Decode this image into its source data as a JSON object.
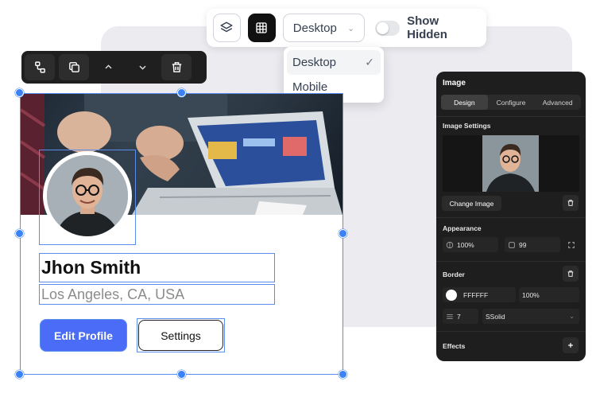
{
  "toolbar": {
    "device_selected": "Desktop",
    "show_hidden_label": "Show Hidden"
  },
  "device_dropdown": {
    "options": [
      {
        "label": "Desktop",
        "selected": true
      },
      {
        "label": "Mobile",
        "selected": false
      }
    ]
  },
  "element_toolbar": {
    "icons": [
      "hierarchy-icon",
      "duplicate-icon",
      "move-up-icon",
      "move-down-icon",
      "delete-icon"
    ]
  },
  "card": {
    "name": "Jhon Smith",
    "location": "Los Angeles, CA, USA",
    "edit_button": "Edit Profile",
    "settings_button": "Settings",
    "accent_color": "#4a6cf7",
    "selection_color": "#3b82f6"
  },
  "panel": {
    "title": "Image",
    "tabs": [
      {
        "label": "Design",
        "active": true
      },
      {
        "label": "Configure",
        "active": false
      },
      {
        "label": "Advanced",
        "active": false
      }
    ],
    "image_settings_label": "Image Settings",
    "change_image_label": "Change Image",
    "appearance_label": "Appearance",
    "opacity_value": "100%",
    "radius_value": "99",
    "border_label": "Border",
    "border_color_hex": "FFFFFF",
    "border_opacity": "100%",
    "border_width": "7",
    "border_style": "SSolid",
    "effects_label": "Effects"
  }
}
